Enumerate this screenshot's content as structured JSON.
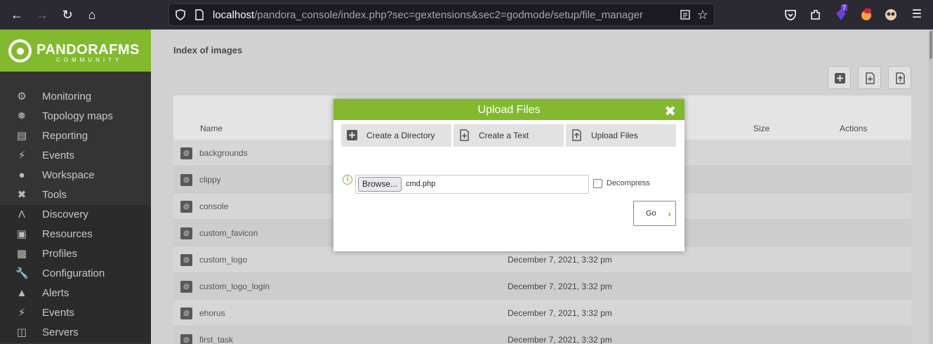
{
  "browser": {
    "url_host": "localhost",
    "url_path": "/pandora_console/index.php?sec=gextensions&sec2=godmode/setup/file_manager",
    "extension_badge": "7"
  },
  "logo": {
    "brand": "PANDORAFMS",
    "sub": "COMMUNITY"
  },
  "sidebar": {
    "top_items": [
      {
        "label": "Monitoring",
        "icon": "pulse-icon"
      },
      {
        "label": "Topology maps",
        "icon": "topology-icon"
      },
      {
        "label": "Reporting",
        "icon": "chart-icon"
      },
      {
        "label": "Events",
        "icon": "bolt-icon"
      },
      {
        "label": "Workspace",
        "icon": "user-icon"
      },
      {
        "label": "Tools",
        "icon": "tools-icon"
      }
    ],
    "bottom_items": [
      {
        "label": "Discovery",
        "icon": "discovery-icon"
      },
      {
        "label": "Resources",
        "icon": "resources-icon"
      },
      {
        "label": "Profiles",
        "icon": "profile-icon"
      },
      {
        "label": "Configuration",
        "icon": "wrench-icon"
      },
      {
        "label": "Alerts",
        "icon": "bell-icon"
      },
      {
        "label": "Events",
        "icon": "bolt-plus-icon"
      },
      {
        "label": "Servers",
        "icon": "server-icon"
      }
    ]
  },
  "main": {
    "title": "Index of images",
    "columns": {
      "name": "Name",
      "size": "Size",
      "actions": "Actions"
    },
    "rows": [
      {
        "name": "backgrounds",
        "date": ""
      },
      {
        "name": "clippy",
        "date": ""
      },
      {
        "name": "console",
        "date": ""
      },
      {
        "name": "custom_favicon",
        "date": ""
      },
      {
        "name": "custom_logo",
        "date": "December 7, 2021, 3:32 pm"
      },
      {
        "name": "custom_logo_login",
        "date": "December 7, 2021, 3:32 pm"
      },
      {
        "name": "ehorus",
        "date": "December 7, 2021, 3:32 pm"
      },
      {
        "name": "first_task",
        "date": "December 7, 2021, 3:32 pm"
      }
    ]
  },
  "modal": {
    "title": "Upload Files",
    "tabs": {
      "create_dir": "Create a Directory",
      "create_text": "Create a Text",
      "upload_files": "Upload Files"
    },
    "browse_label": "Browse...",
    "file_name": "cmd.php",
    "decompress_label": "Decompress",
    "go_label": "Go"
  },
  "colors": {
    "accent": "#82b92e",
    "sidebar": "#343434"
  }
}
